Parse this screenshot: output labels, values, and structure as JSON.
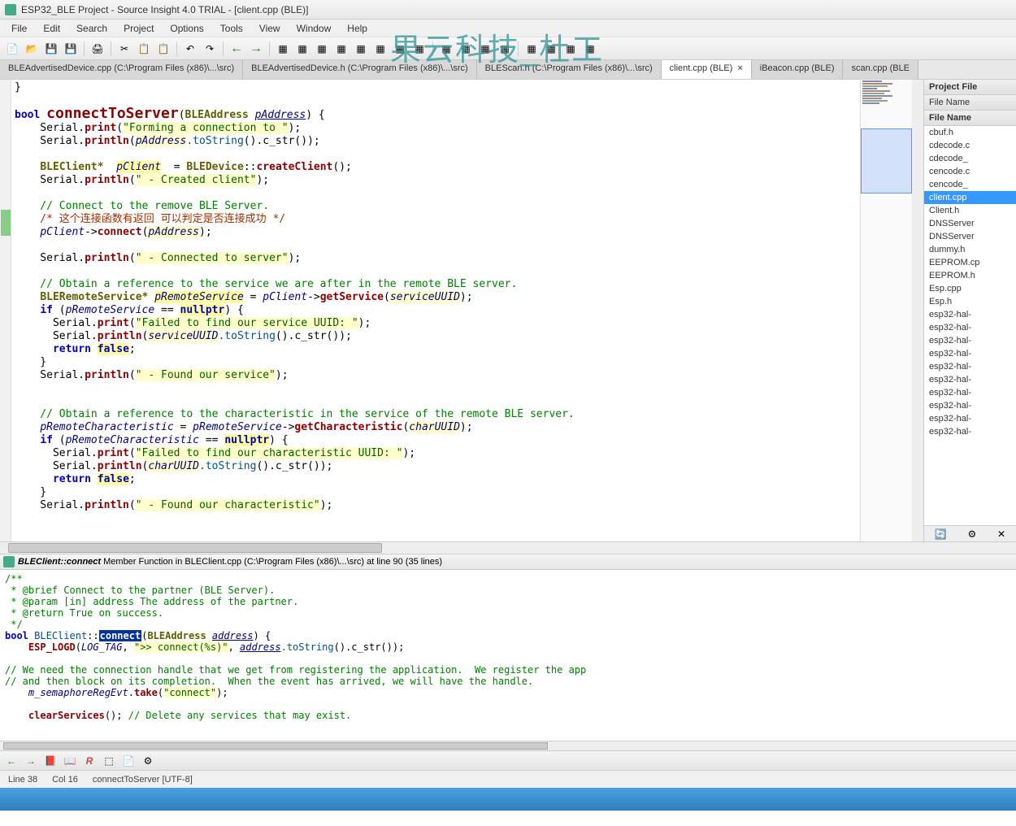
{
  "window": {
    "title": "ESP32_BLE Project - Source Insight 4.0 TRIAL - [client.cpp (BLE)]"
  },
  "watermark": "果云科技_杜工",
  "menu": [
    "File",
    "Edit",
    "Search",
    "Project",
    "Options",
    "Tools",
    "View",
    "Window",
    "Help"
  ],
  "tabs": [
    {
      "label": "BLEAdvertisedDevice.cpp (C:\\Program Files (x86)\\...\\src)",
      "active": false
    },
    {
      "label": "BLEAdvertisedDevice.h (C:\\Program Files (x86)\\...\\src)",
      "active": false
    },
    {
      "label": "BLEScan.h (C:\\Program Files (x86)\\...\\src)",
      "active": false
    },
    {
      "label": "client.cpp (BLE)",
      "active": true,
      "close": true
    },
    {
      "label": "iBeacon.cpp (BLE)",
      "active": false
    },
    {
      "label": "scan.cpp (BLE",
      "active": false
    }
  ],
  "sidebar": {
    "header1": "Project File",
    "header2": "File Name",
    "header3": "File Name",
    "files": [
      {
        "name": "cbuf.h"
      },
      {
        "name": "cdecode.c"
      },
      {
        "name": "cdecode_"
      },
      {
        "name": "cencode.c"
      },
      {
        "name": "cencode_"
      },
      {
        "name": "client.cpp",
        "selected": true
      },
      {
        "name": "Client.h"
      },
      {
        "name": "DNSServer"
      },
      {
        "name": "DNSServer"
      },
      {
        "name": "dummy.h"
      },
      {
        "name": "EEPROM.cp"
      },
      {
        "name": "EEPROM.h"
      },
      {
        "name": "Esp.cpp"
      },
      {
        "name": "Esp.h"
      },
      {
        "name": "esp32-hal-"
      },
      {
        "name": "esp32-hal-"
      },
      {
        "name": "esp32-hal-"
      },
      {
        "name": "esp32-hal-"
      },
      {
        "name": "esp32-hal-"
      },
      {
        "name": "esp32-hal-"
      },
      {
        "name": "esp32-hal-"
      },
      {
        "name": "esp32-hal-"
      },
      {
        "name": "esp32-hal-"
      },
      {
        "name": "esp32-hal-"
      }
    ]
  },
  "context": {
    "symbol": "BLEClient::connect",
    "desc": "Member Function in BLEClient.cpp (C:\\Program Files (x86)\\...\\src) at line 90 (35 lines)"
  },
  "status": {
    "line": "Line 38",
    "col": "Col 16",
    "fn": "connectToServer [UTF-8]"
  },
  "code_main": {
    "l01": "}",
    "l02": "",
    "l03_kw": "bool",
    "l03_fn": "connectToServer",
    "l03_ty": "BLEAddress",
    "l03_p": "pAddress",
    "l04_pre": "    Serial.",
    "l04_fn": "print",
    "l04_str": "\"Forming a connection to \"",
    "l05_pre": "    Serial.",
    "l05_fn": "println",
    "l05_a": "pAddress",
    "l05_m": ".toString",
    "l06": "",
    "l07_ty": "BLEClient*",
    "l07_v": "pClient",
    "l07_cls": "BLEDevice",
    "l07_fn": "createClient",
    "l08_pre": "    Serial.",
    "l08_fn": "println",
    "l08_str": "\" - Created client\"",
    "l09": "",
    "l10": "    // Connect to the remove BLE Server.",
    "l11": "    /* 这个连接函数有返回 可以判定是否连接成功 */",
    "l12_v": "pClient",
    "l12_fn": "connect",
    "l12_a": "pAddress",
    "l13": "",
    "l14_pre": "    Serial.",
    "l14_fn": "println",
    "l14_str": "\" - Connected to server\"",
    "l15": "",
    "l16": "    // Obtain a reference to the service we are after in the remote BLE server.",
    "l17_ty": "BLERemoteService*",
    "l17_v": "pRemoteService",
    "l17_c": "pClient",
    "l17_fn": "getService",
    "l17_a": "serviceUUID",
    "l18_kw": "if",
    "l18_v": "pRemoteService",
    "l18_n": "nullptr",
    "l19_pre": "      Serial.",
    "l19_fn": "print",
    "l19_str": "\"Failed to find our service UUID: \"",
    "l20_pre": "      Serial.",
    "l20_fn": "println",
    "l20_a": "serviceUUID",
    "l20_m": ".toString",
    "l21_kw": "return",
    "l21_v": "false",
    "l22": "    }",
    "l23_pre": "    Serial.",
    "l23_fn": "println",
    "l23_str": "\" - Found our service\"",
    "l24": "",
    "l25": "",
    "l26": "    // Obtain a reference to the characteristic in the service of the remote BLE server.",
    "l27_v": "pRemoteCharacteristic",
    "l27_c": "pRemoteService",
    "l27_fn": "getCharacteristic",
    "l27_a": "charUUID",
    "l28_kw": "if",
    "l28_v": "pRemoteCharacteristic",
    "l28_n": "nullptr",
    "l29_pre": "      Serial.",
    "l29_fn": "print",
    "l29_str": "\"Failed to find our characteristic UUID: \"",
    "l30_pre": "      Serial.",
    "l30_fn": "println",
    "l30_a": "charUUID",
    "l30_m": ".toString",
    "l31_kw": "return",
    "l31_v": "false",
    "l32": "    }",
    "l33_pre": "    Serial.",
    "l33_fn": "println",
    "l33_str": "\" - Found our characteristic\"",
    "l34": ""
  },
  "code_lower": {
    "l1": "/**",
    "l2": " * @brief Connect to the partner (BLE Server).",
    "l3": " * @param [in] address The address of the partner.",
    "l4": " * @return True on success.",
    "l5": " */",
    "l6_kw": "bool",
    "l6_cls": "BLEClient",
    "l6_fn": "connect",
    "l6_ty": "BLEAddress",
    "l6_p": "address",
    "l7_fn": "ESP_LOGD",
    "l7_a": "LOG_TAG",
    "l7_str": "\">> connect(%s)\"",
    "l7_b": "address",
    "l7_m": ".toString",
    "l8": "",
    "l9": "// We need the connection handle that we get from registering the application.  We register the app",
    "l10": "// and then block on its completion.  When the event has arrived, we will have the handle.",
    "l11_v": "m_semaphoreRegEvt",
    "l11_fn": "take",
    "l11_str": "\"connect\"",
    "l12": "",
    "l13_fn": "clearServices",
    "l13_cm": "// Delete any services that may exist."
  }
}
